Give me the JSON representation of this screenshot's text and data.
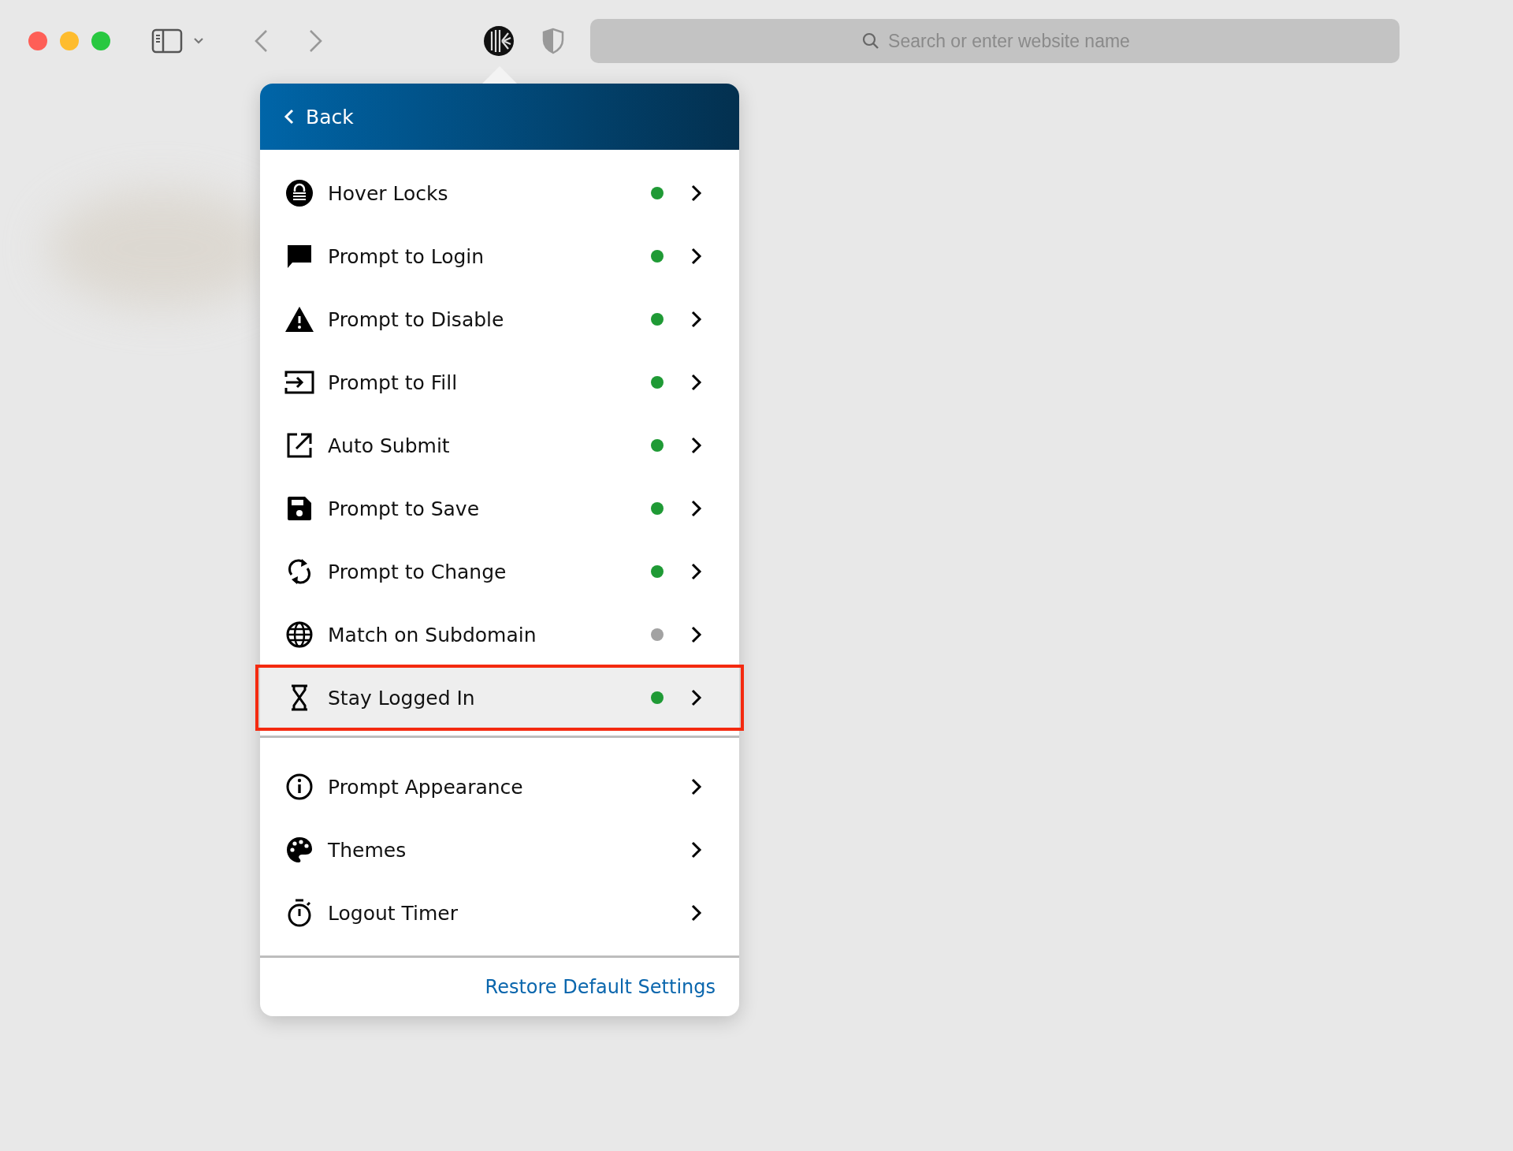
{
  "toolbar": {
    "search": {
      "placeholder": "Search or enter website name"
    }
  },
  "popup": {
    "back": "Back",
    "settings": [
      {
        "label": "Hover Locks",
        "on": true,
        "selected": false
      },
      {
        "label": "Prompt to Login",
        "on": true,
        "selected": false
      },
      {
        "label": "Prompt to Disable",
        "on": true,
        "selected": false
      },
      {
        "label": "Prompt to Fill",
        "on": true,
        "selected": false
      },
      {
        "label": "Auto Submit",
        "on": true,
        "selected": false
      },
      {
        "label": "Prompt to Save",
        "on": true,
        "selected": false
      },
      {
        "label": "Prompt to Change",
        "on": true,
        "selected": false
      },
      {
        "label": "Match on Subdomain",
        "on": false,
        "selected": false
      },
      {
        "label": "Stay Logged In",
        "on": true,
        "selected": true
      }
    ],
    "more_settings": [
      {
        "label": "Prompt Appearance"
      },
      {
        "label": "Themes"
      },
      {
        "label": "Logout Timer"
      }
    ],
    "restore_link": "Restore Default Settings"
  }
}
